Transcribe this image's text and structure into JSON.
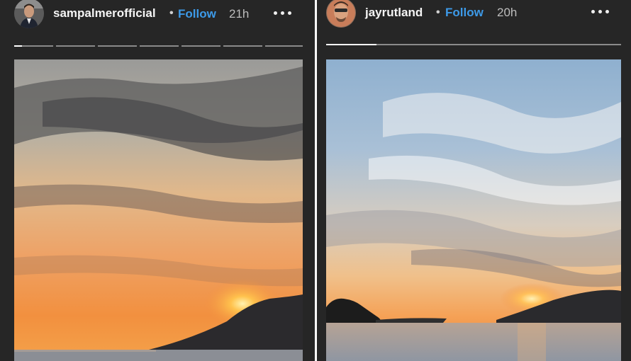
{
  "stories": [
    {
      "username": "sampalmerofficial",
      "separator": "•",
      "follow_label": "Follow",
      "time": "21h",
      "segments_total": 7,
      "active_segment": 1,
      "active_segment_progress": 0.2,
      "image": "sunset-over-sea-photo"
    },
    {
      "username": "jayrutland",
      "separator": "•",
      "follow_label": "Follow",
      "time": "20h",
      "segments_total": 1,
      "active_segment": 1,
      "active_segment_progress": 0.17,
      "image": "sunset-over-sea-photo"
    }
  ],
  "colors": {
    "background": "#262626",
    "follow": "#3d9ae8",
    "progress_track": "#8a8a8a",
    "progress_fill": "#ffffff"
  }
}
